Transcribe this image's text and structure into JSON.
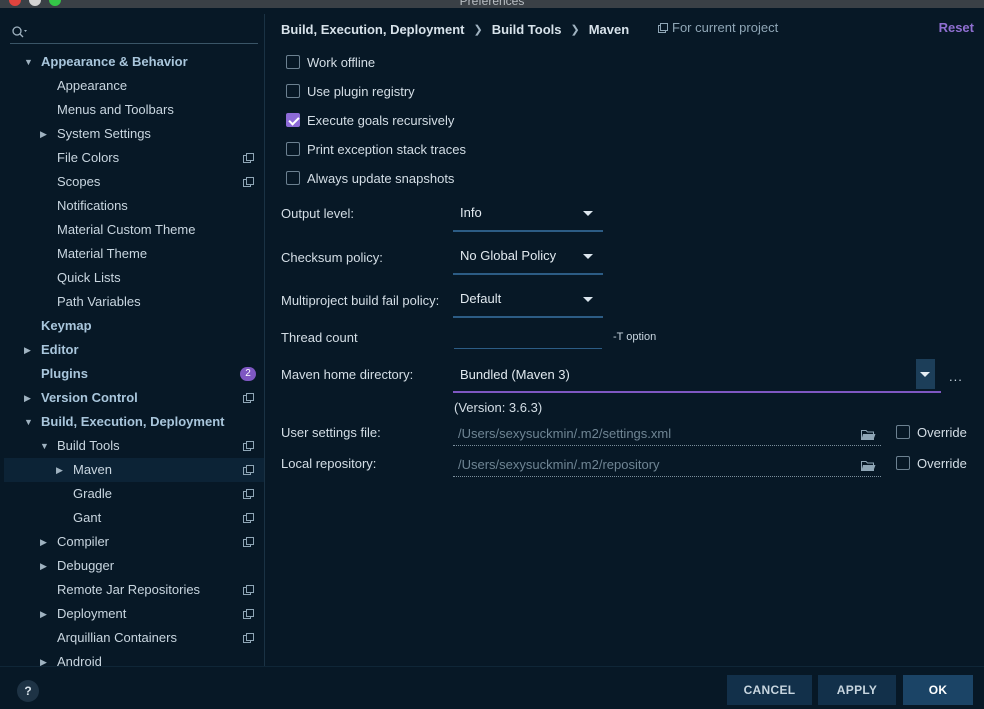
{
  "window": {
    "title": "Preferences"
  },
  "search": {
    "placeholder": ""
  },
  "sidebar": {
    "items": [
      {
        "label": "Appearance & Behavior",
        "arrow": "▼",
        "bold": true,
        "indent": 0,
        "proj": false
      },
      {
        "label": "Appearance",
        "arrow": "",
        "bold": false,
        "indent": 1,
        "proj": false
      },
      {
        "label": "Menus and Toolbars",
        "arrow": "",
        "bold": false,
        "indent": 1,
        "proj": false
      },
      {
        "label": "System Settings",
        "arrow": "▶",
        "bold": false,
        "indent": 1,
        "proj": false
      },
      {
        "label": "File Colors",
        "arrow": "",
        "bold": false,
        "indent": 1,
        "proj": true
      },
      {
        "label": "Scopes",
        "arrow": "",
        "bold": false,
        "indent": 1,
        "proj": true
      },
      {
        "label": "Notifications",
        "arrow": "",
        "bold": false,
        "indent": 1,
        "proj": false
      },
      {
        "label": "Material Custom Theme",
        "arrow": "",
        "bold": false,
        "indent": 1,
        "proj": false
      },
      {
        "label": "Material Theme",
        "arrow": "",
        "bold": false,
        "indent": 1,
        "proj": false
      },
      {
        "label": "Quick Lists",
        "arrow": "",
        "bold": false,
        "indent": 1,
        "proj": false
      },
      {
        "label": "Path Variables",
        "arrow": "",
        "bold": false,
        "indent": 1,
        "proj": false
      },
      {
        "label": "Keymap",
        "arrow": "",
        "bold": true,
        "indent": 0,
        "proj": false
      },
      {
        "label": "Editor",
        "arrow": "▶",
        "bold": true,
        "indent": 0,
        "proj": false
      },
      {
        "label": "Plugins",
        "arrow": "",
        "bold": true,
        "indent": 0,
        "proj": false,
        "badge": "2"
      },
      {
        "label": "Version Control",
        "arrow": "▶",
        "bold": true,
        "indent": 0,
        "proj": true
      },
      {
        "label": "Build, Execution, Deployment",
        "arrow": "▼",
        "bold": true,
        "indent": 0,
        "proj": false
      },
      {
        "label": "Build Tools",
        "arrow": "▼",
        "bold": false,
        "indent": 1,
        "proj": true
      },
      {
        "label": "Maven",
        "arrow": "▶",
        "bold": false,
        "indent": 2,
        "proj": true,
        "selected": true
      },
      {
        "label": "Gradle",
        "arrow": "",
        "bold": false,
        "indent": 2,
        "proj": true
      },
      {
        "label": "Gant",
        "arrow": "",
        "bold": false,
        "indent": 2,
        "proj": true
      },
      {
        "label": "Compiler",
        "arrow": "▶",
        "bold": false,
        "indent": 1,
        "proj": true
      },
      {
        "label": "Debugger",
        "arrow": "▶",
        "bold": false,
        "indent": 1,
        "proj": false
      },
      {
        "label": "Remote Jar Repositories",
        "arrow": "",
        "bold": false,
        "indent": 1,
        "proj": true
      },
      {
        "label": "Deployment",
        "arrow": "▶",
        "bold": false,
        "indent": 1,
        "proj": true
      },
      {
        "label": "Arquillian Containers",
        "arrow": "",
        "bold": false,
        "indent": 1,
        "proj": true
      },
      {
        "label": "Android",
        "arrow": "▶",
        "bold": false,
        "indent": 1,
        "proj": false
      }
    ]
  },
  "breadcrumb": [
    "Build, Execution, Deployment",
    "Build Tools",
    "Maven"
  ],
  "header": {
    "for_current_project": "For current project",
    "reset": "Reset"
  },
  "checkboxes": [
    {
      "label": "Work offline",
      "checked": false
    },
    {
      "label": "Use plugin registry",
      "checked": false
    },
    {
      "label": "Execute goals recursively",
      "checked": true
    },
    {
      "label": "Print exception stack traces",
      "checked": false
    },
    {
      "label": "Always update snapshots",
      "checked": false
    }
  ],
  "fields": {
    "output_level": {
      "label": "Output level:",
      "value": "Info"
    },
    "checksum_policy": {
      "label": "Checksum policy:",
      "value": "No Global Policy"
    },
    "fail_policy": {
      "label": "Multiproject build fail policy:",
      "value": "Default"
    },
    "thread_count": {
      "label": "Thread count",
      "value": "",
      "hint": "-T option"
    },
    "maven_home": {
      "label": "Maven home directory:",
      "value": "Bundled (Maven 3)",
      "version": "(Version: 3.6.3)",
      "ellipsis": "..."
    },
    "user_settings": {
      "label": "User settings file:",
      "value": "/Users/sexysuckmin/.m2/settings.xml",
      "override": "Override",
      "override_checked": false
    },
    "local_repo": {
      "label": "Local repository:",
      "value": "/Users/sexysuckmin/.m2/repository",
      "override": "Override",
      "override_checked": false
    }
  },
  "footer": {
    "help": "?",
    "cancel": "CANCEL",
    "apply": "APPLY",
    "ok": "OK"
  },
  "colors": {
    "accent": "#7e57c2",
    "background": "#071826",
    "button": "#12304a"
  }
}
